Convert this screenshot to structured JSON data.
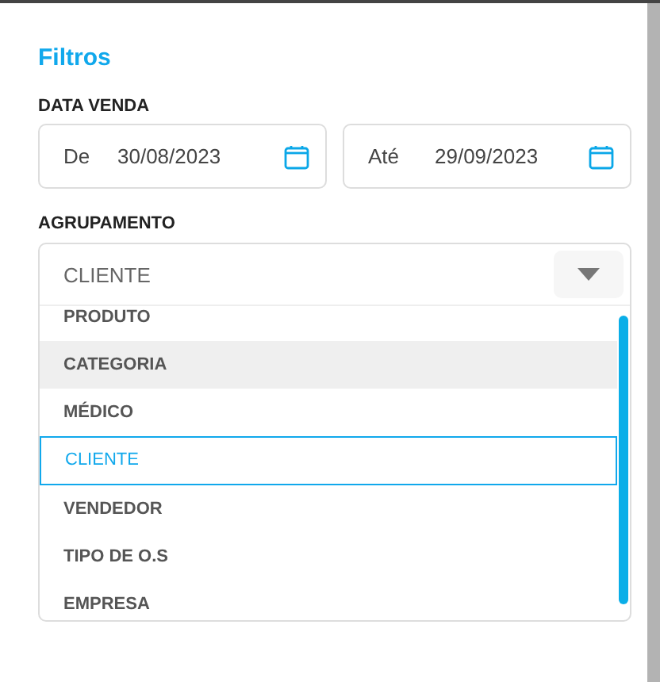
{
  "title": "Filtros",
  "sale_date": {
    "label": "DATA VENDA",
    "from": {
      "label": "De",
      "value": "30/08/2023"
    },
    "to": {
      "label": "Até",
      "value": "29/09/2023"
    }
  },
  "grouping": {
    "label": "AGRUPAMENTO",
    "value": "CLIENTE",
    "expanded": true,
    "options": [
      {
        "label": "PRODUTO",
        "selected": false,
        "hovered": false
      },
      {
        "label": "CATEGORIA",
        "selected": false,
        "hovered": true
      },
      {
        "label": "MÉDICO",
        "selected": false,
        "hovered": false
      },
      {
        "label": "CLIENTE",
        "selected": true,
        "hovered": false
      },
      {
        "label": "VENDEDOR",
        "selected": false,
        "hovered": false
      },
      {
        "label": "TIPO DE O.S",
        "selected": false,
        "hovered": false
      },
      {
        "label": "EMPRESA",
        "selected": false,
        "hovered": false
      }
    ]
  }
}
